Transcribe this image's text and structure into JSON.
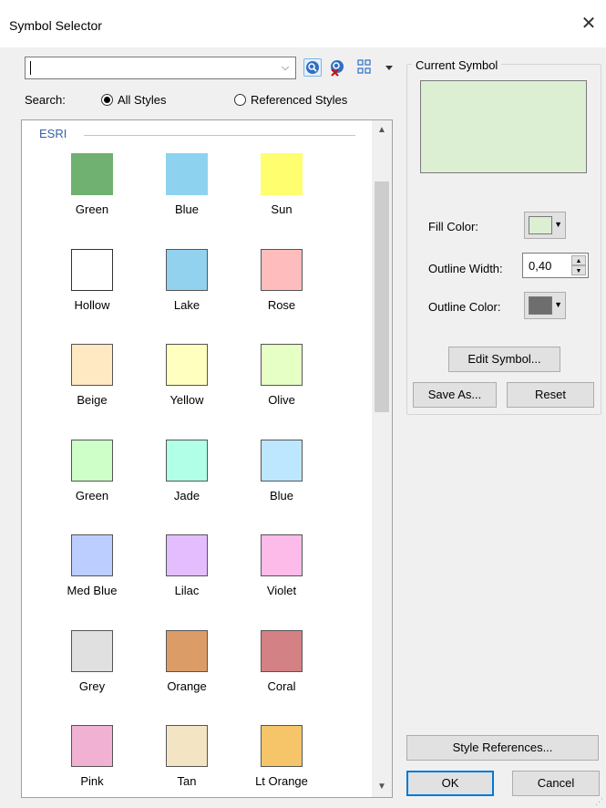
{
  "window": {
    "title": "Symbol Selector",
    "close_glyph": "✕"
  },
  "search": {
    "value": "",
    "combo_arrow": "⌵"
  },
  "search_scope": {
    "label": "Search:",
    "all_styles": "All Styles",
    "referenced_styles": "Referenced Styles",
    "selected": "All Styles"
  },
  "gallery": {
    "group": "ESRI",
    "symbols": [
      {
        "name": "Green",
        "color": "#70b070",
        "border": "#70b070"
      },
      {
        "name": "Blue",
        "color": "#8dd3f0",
        "border": "#8dd3f0"
      },
      {
        "name": "Sun",
        "color": "#fefe6e",
        "border": "#fefe6e"
      },
      {
        "name": "Hollow",
        "color": "#ffffff",
        "border": "#333333"
      },
      {
        "name": "Lake",
        "color": "#92d2ef",
        "border": "#555555"
      },
      {
        "name": "Rose",
        "color": "#ffbcbc",
        "border": "#555555"
      },
      {
        "name": "Beige",
        "color": "#ffe9c2",
        "border": "#555555"
      },
      {
        "name": "Yellow",
        "color": "#ffffc0",
        "border": "#555555"
      },
      {
        "name": "Olive",
        "color": "#e6ffc4",
        "border": "#555555"
      },
      {
        "name": "Green",
        "color": "#cfffc8",
        "border": "#555555"
      },
      {
        "name": "Jade",
        "color": "#b2ffe8",
        "border": "#555555"
      },
      {
        "name": "Blue",
        "color": "#bde6ff",
        "border": "#555555"
      },
      {
        "name": "Med Blue",
        "color": "#bccdff",
        "border": "#555555"
      },
      {
        "name": "Lilac",
        "color": "#e4bdff",
        "border": "#555555"
      },
      {
        "name": "Violet",
        "color": "#fcbbe8",
        "border": "#555555"
      },
      {
        "name": "Grey",
        "color": "#e0e0e0",
        "border": "#555555"
      },
      {
        "name": "Orange",
        "color": "#dc9c68",
        "border": "#555555"
      },
      {
        "name": "Coral",
        "color": "#d48185",
        "border": "#555555"
      },
      {
        "name": "Pink",
        "color": "#f0b1d3",
        "border": "#555555"
      },
      {
        "name": "Tan",
        "color": "#f3e5c4",
        "border": "#555555"
      },
      {
        "name": "Lt Orange",
        "color": "#f6c56a",
        "border": "#555555"
      }
    ]
  },
  "scrollbar": {
    "up": "▲",
    "down": "▼"
  },
  "current_symbol": {
    "title": "Current Symbol",
    "preview_color": "#dcefd3",
    "fill_color_label": "Fill Color:",
    "fill_color_value": "#dcefd3",
    "outline_width_label": "Outline Width:",
    "outline_width_value": "0,40",
    "outline_color_label": "Outline Color:",
    "outline_color_value": "#6e6e6e"
  },
  "buttons": {
    "edit_symbol": "Edit Symbol...",
    "save_as": "Save As...",
    "reset": "Reset",
    "style_references": "Style References...",
    "ok": "OK",
    "cancel": "Cancel"
  }
}
